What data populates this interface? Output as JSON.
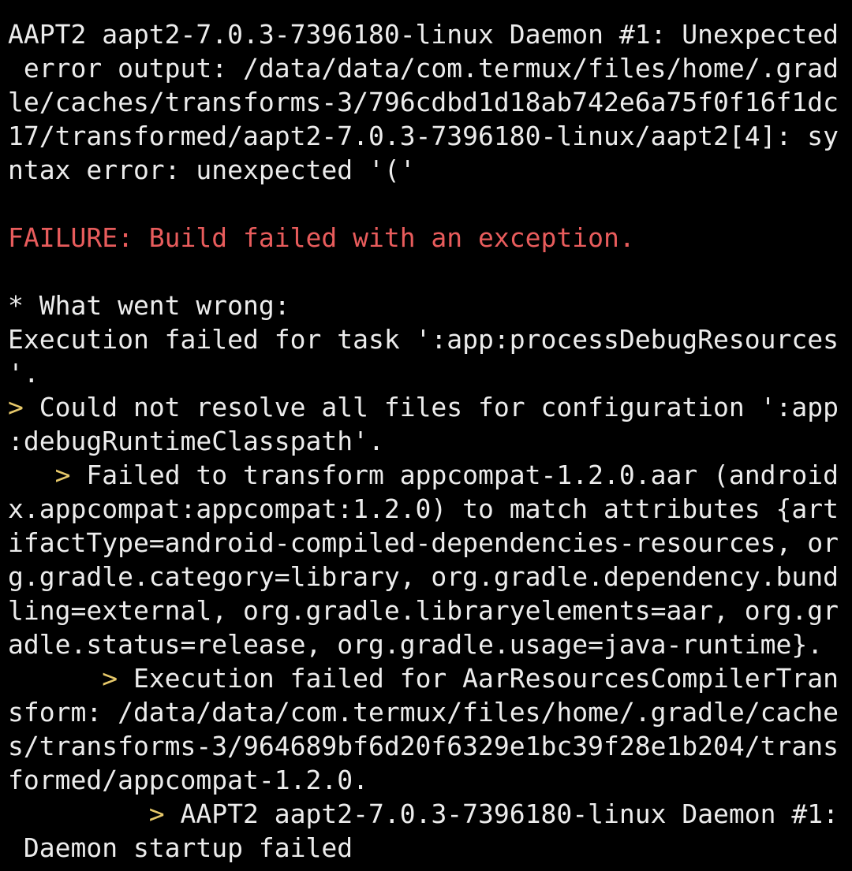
{
  "colors": {
    "background": "#000000",
    "foreground": "#ececec",
    "error": "#e85c5c",
    "prompt_marker": "#e6c86a"
  },
  "terminal": {
    "lines": [
      {
        "prefix": "",
        "text": "AAPT2 aapt2-7.0.3-7396180-linux Daemon #1: Unexpected"
      },
      {
        "prefix": "",
        "text": " error output: /data/data/com.termux/files/home/.grad"
      },
      {
        "prefix": "",
        "text": "le/caches/transforms-3/796cdbd1d18ab742e6a75f0f16f1dc"
      },
      {
        "prefix": "",
        "text": "17/transformed/aapt2-7.0.3-7396180-linux/aapt2[4]: sy"
      },
      {
        "prefix": "",
        "text": "ntax error: unexpected '('"
      },
      {
        "prefix": "",
        "text": ""
      },
      {
        "prefix": "",
        "text": "FAILURE: Build failed with an exception."
      },
      {
        "prefix": "",
        "text": ""
      },
      {
        "prefix": "",
        "text": "* What went wrong:"
      },
      {
        "prefix": "",
        "text": "Execution failed for task ':app:processDebugResources"
      },
      {
        "prefix": "",
        "text": "'."
      },
      {
        "prefix": ">",
        "text": " Could not resolve all files for configuration ':app"
      },
      {
        "prefix": "",
        "text": ":debugRuntimeClasspath'."
      },
      {
        "prefix": "   >",
        "text": " Failed to transform appcompat-1.2.0.aar (android"
      },
      {
        "prefix": "",
        "text": "x.appcompat:appcompat:1.2.0) to match attributes {art"
      },
      {
        "prefix": "",
        "text": "ifactType=android-compiled-dependencies-resources, or"
      },
      {
        "prefix": "",
        "text": "g.gradle.category=library, org.gradle.dependency.bund"
      },
      {
        "prefix": "",
        "text": "ling=external, org.gradle.libraryelements=aar, org.gr"
      },
      {
        "prefix": "",
        "text": "adle.status=release, org.gradle.usage=java-runtime}."
      },
      {
        "prefix": "      >",
        "text": " Execution failed for AarResourcesCompilerTran"
      },
      {
        "prefix": "",
        "text": "sform: /data/data/com.termux/files/home/.gradle/cache"
      },
      {
        "prefix": "",
        "text": "s/transforms-3/964689bf6d20f6329e1bc39f28e1b204/trans"
      },
      {
        "prefix": "",
        "text": "formed/appcompat-1.2.0."
      },
      {
        "prefix": "         >",
        "text": " AAPT2 aapt2-7.0.3-7396180-linux Daemon #1:"
      },
      {
        "prefix": "",
        "text": " Daemon startup failed"
      }
    ]
  }
}
